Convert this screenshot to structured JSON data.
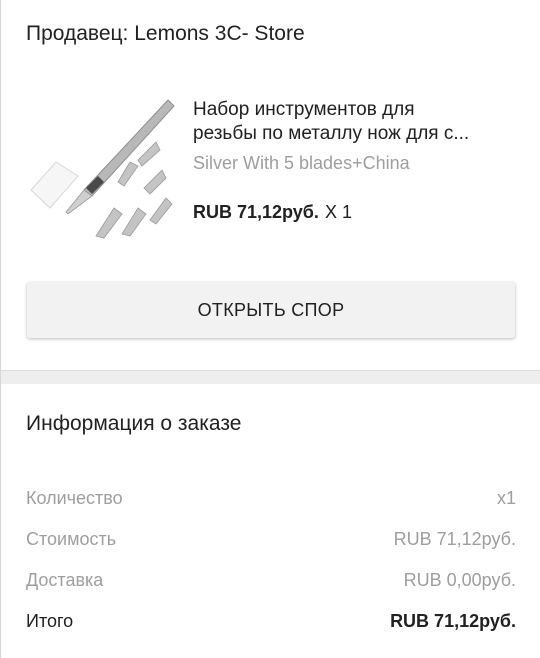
{
  "seller": {
    "title": "Продавец: Lemons 3C- Store"
  },
  "product": {
    "name_line1": "Набор инструментов для",
    "name_line2": "резьбы по металлу нож для с...",
    "variant": "Silver With 5 blades+China",
    "price": "RUB 71,12руб.",
    "quantity": "X 1"
  },
  "actions": {
    "open_dispute_label": "ОТКРЫТЬ СПОР"
  },
  "order_info": {
    "title": "Информация о заказе",
    "rows": [
      {
        "label": "Количество",
        "value": "x1"
      },
      {
        "label": "Стоимость",
        "value": "RUB 71,12руб."
      },
      {
        "label": "Доставка",
        "value": "RUB 0,00руб."
      }
    ],
    "total": {
      "label": "Итого",
      "value": "RUB 71,12руб."
    }
  },
  "colors": {
    "primary_text": "#212121",
    "secondary_text": "#9e9e9e",
    "button_bg": "#f2f2f2",
    "divider": "#eeeeee"
  }
}
